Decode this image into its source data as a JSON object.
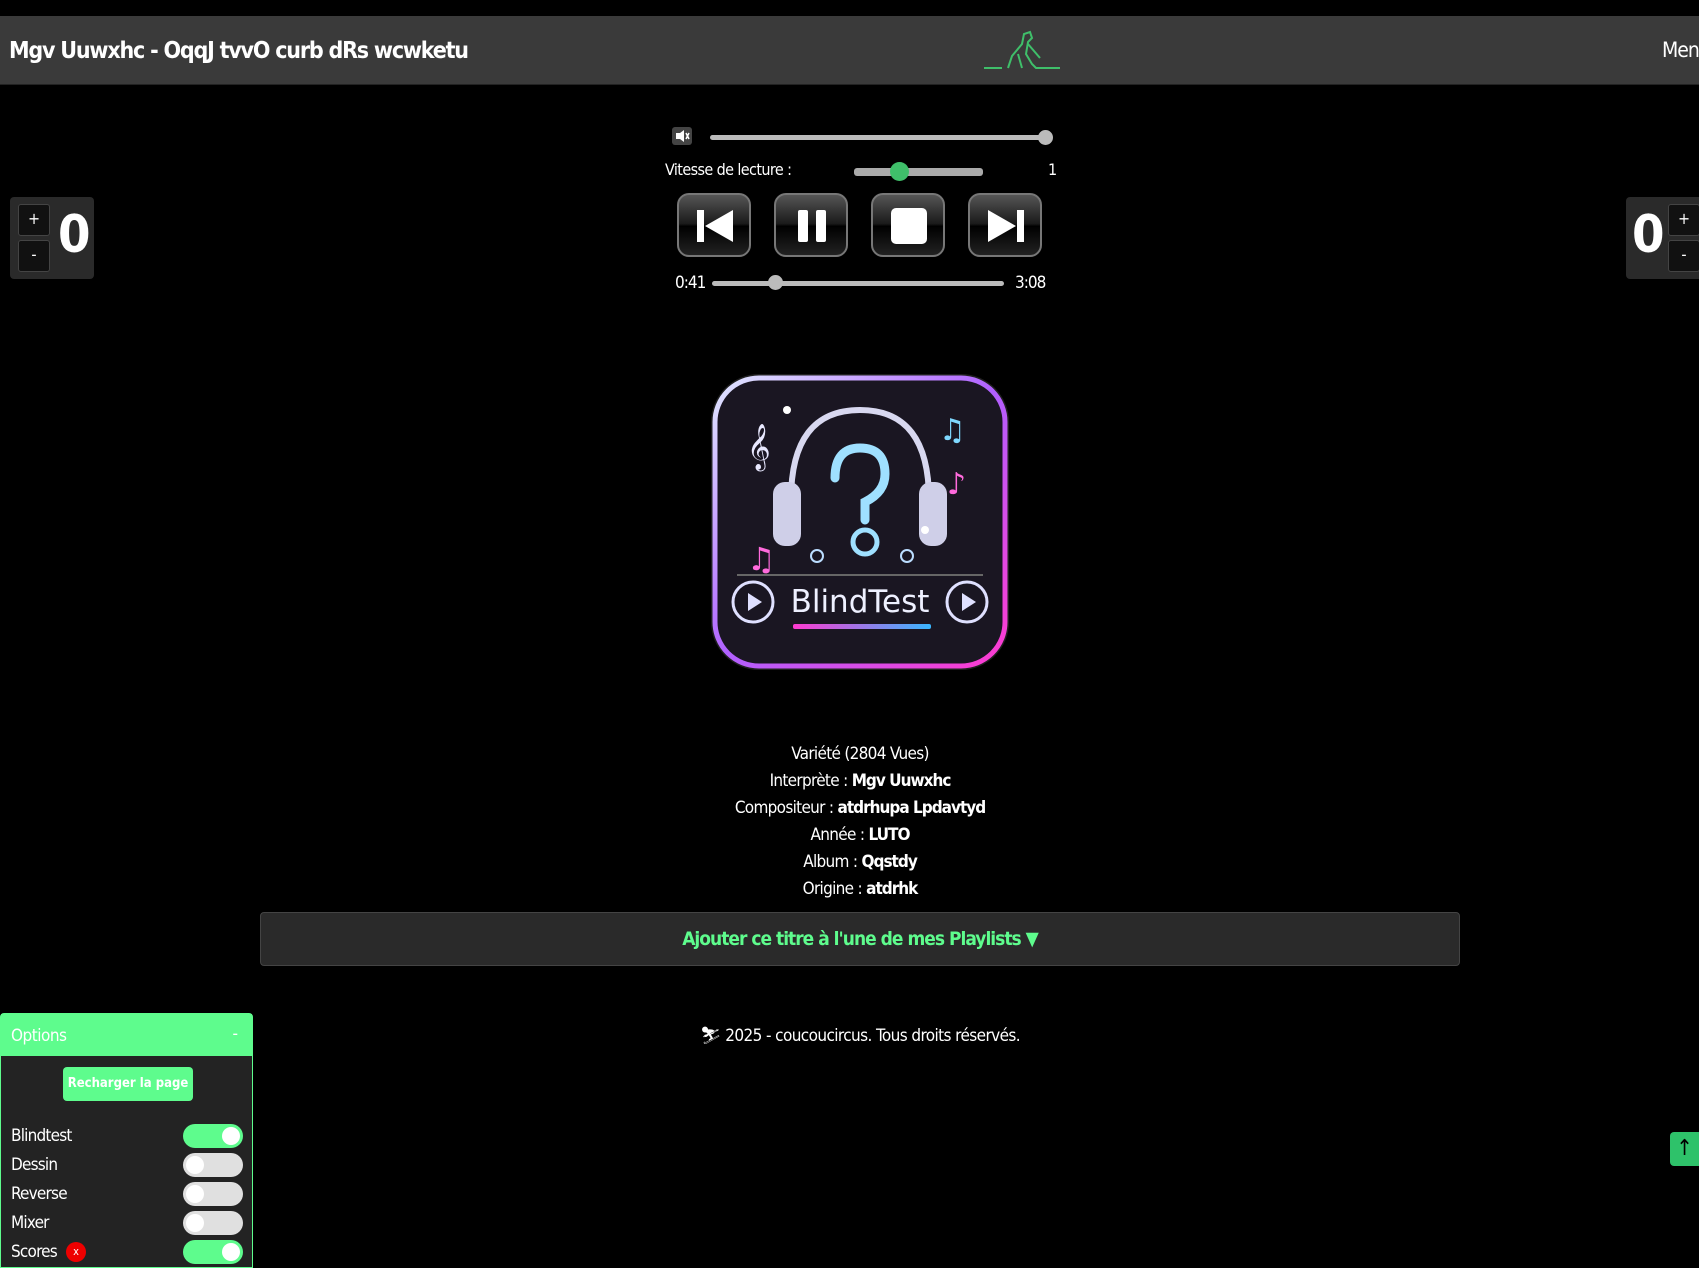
{
  "header": {
    "title": "Mgv Uuwxhc - OqqJ tvvO curb dRs wcwketu",
    "menu_label": "Menu",
    "logo_icon": "penguin-logo-icon"
  },
  "scores": {
    "left": {
      "plus": "+",
      "minus": "-",
      "value": "0"
    },
    "right": {
      "plus": "+",
      "minus": "-",
      "value": "0"
    }
  },
  "player": {
    "volume_icon": "volume-mute-icon",
    "volume_level": 1.0,
    "speed_label": "Vitesse de lecture :",
    "speed_value": "1",
    "controls": [
      "previous",
      "pause",
      "stop",
      "next"
    ],
    "current_time": "0:41",
    "duration": "3:08",
    "progress": 0.218
  },
  "artwork": {
    "text": "BlindTest",
    "alt_icon": "blindtest-headphones-question-icon"
  },
  "info": {
    "genre_views": "Variété (2804 Vues)",
    "interprete_label": "Interprète :",
    "interprete": "Mgv Uuwxhc",
    "compositeur_label": "Compositeur :",
    "compositeur": "atdrhupa Lpdavtyd",
    "annee_label": "Année :",
    "annee": "LUTO",
    "album_label": "Album :",
    "album": "Qqstdy",
    "origine_label": "Origine :",
    "origine": "atdrhk"
  },
  "add_playlist": "Ajouter ce titre à l'une de mes Playlists ▼",
  "footer": "2025 - coucoucircus. Tous droits réservés.",
  "options": {
    "title": "Options",
    "collapse": "-",
    "reload": "Recharger la page",
    "items": [
      {
        "label": "Blindtest",
        "on": true
      },
      {
        "label": "Dessin",
        "on": false
      },
      {
        "label": "Reverse",
        "on": false
      },
      {
        "label": "Mixer",
        "on": false
      },
      {
        "label": "Scores",
        "on": true,
        "badge": "x"
      }
    ]
  },
  "scroll_top": "↑",
  "colors": {
    "accent": "#5efc8d",
    "header": "#3a3a3a",
    "badge": "#ee0000"
  }
}
